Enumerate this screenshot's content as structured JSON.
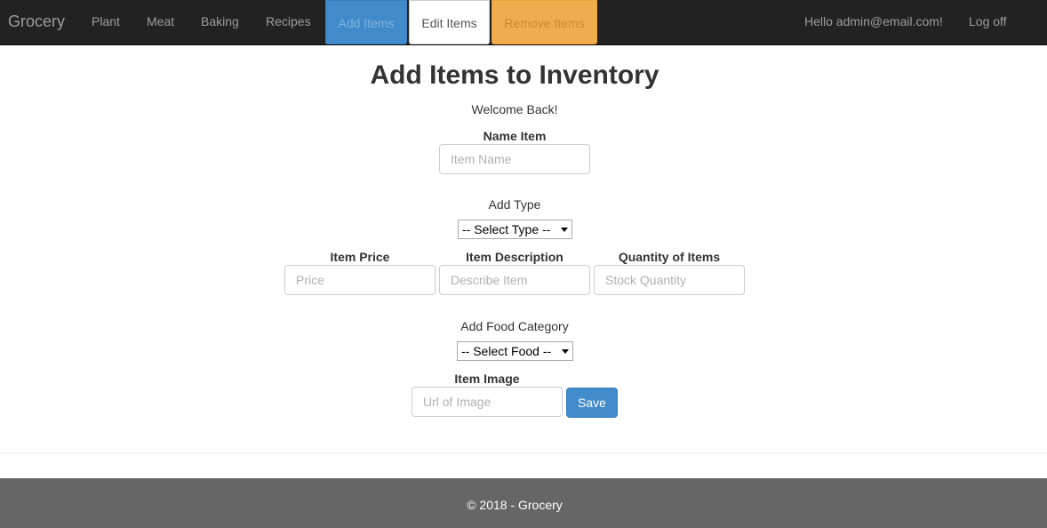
{
  "navbar": {
    "brand": "Grocery",
    "links": [
      "Plant",
      "Meat",
      "Baking",
      "Recipes"
    ],
    "buttons": {
      "add": "Add Items",
      "edit": "Edit Items",
      "remove": "Remove Items"
    },
    "greeting": "Hello admin@email.com!",
    "logoff": "Log off"
  },
  "page": {
    "title": "Add Items to Inventory",
    "welcome": "Welcome Back!"
  },
  "form": {
    "name_label": "Name Item",
    "name_placeholder": "Item Name",
    "type_label": "Add Type",
    "type_selected": "-- Select Type --",
    "price_label": "Item Price",
    "price_placeholder": "Price",
    "description_label": "Item Description",
    "description_placeholder": "Describe Item",
    "quantity_label": "Quantity of Items",
    "quantity_placeholder": "Stock Quantity",
    "category_label": "Add Food Category",
    "category_selected": "-- Select Food --",
    "image_label": "Item Image",
    "image_placeholder": "Url of Image",
    "save_label": "Save"
  },
  "footer": {
    "text": "© 2018 - Grocery"
  },
  "colors": {
    "navbar_bg": "#222222",
    "primary": "#428bca",
    "warning": "#f0ad4e",
    "footer_bg": "#666666"
  }
}
